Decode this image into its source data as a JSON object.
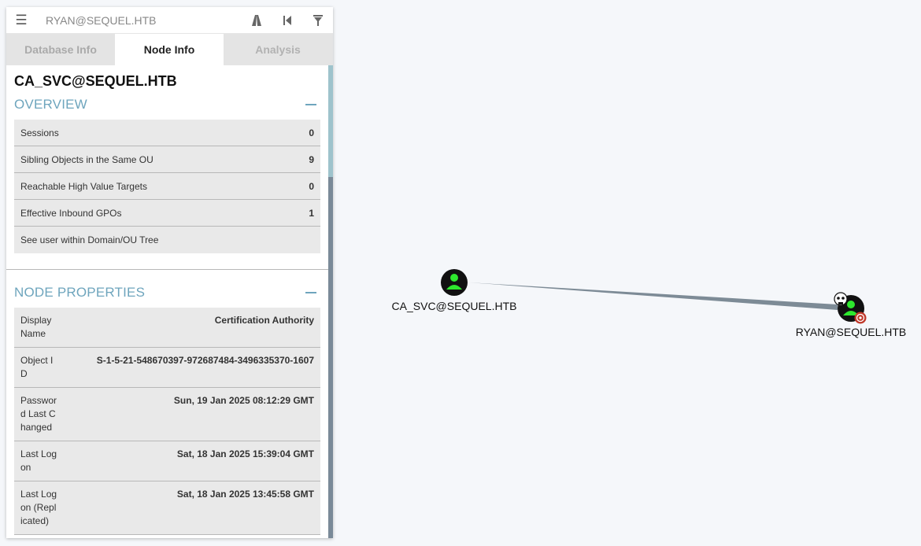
{
  "search": {
    "value": "RYAN@SEQUEL.HTB"
  },
  "tabs": [
    "Database Info",
    "Node Info",
    "Analysis"
  ],
  "node": {
    "title": "CA_SVC@SEQUEL.HTB"
  },
  "overview": {
    "title": "OVERVIEW",
    "rows": [
      {
        "label": "Sessions",
        "value": "0"
      },
      {
        "label": "Sibling Objects in the Same OU",
        "value": "9"
      },
      {
        "label": "Reachable High Value Targets",
        "value": "0"
      },
      {
        "label": "Effective Inbound GPOs",
        "value": "1"
      }
    ],
    "link": "See user within Domain/OU Tree"
  },
  "properties": {
    "title": "NODE PROPERTIES",
    "rows": [
      {
        "label": "Display Name",
        "value": "Certification Authority"
      },
      {
        "label": "Object ID",
        "value": "S-1-5-21-548670397-972687484-3496335370-1607"
      },
      {
        "label": "Password Last Changed",
        "value": "Sun, 19 Jan 2025 08:12:29 GMT"
      },
      {
        "label": "Last Logon",
        "value": "Sat, 18 Jan 2025 15:39:04 GMT"
      },
      {
        "label": "Last Logon (Replicated)",
        "value": "Sat, 18 Jan 2025 13:45:58 GMT"
      }
    ]
  },
  "graph": {
    "nodes": [
      {
        "label": "CA_SVC@SEQUEL.HTB"
      },
      {
        "label": "RYAN@SEQUEL.HTB"
      }
    ],
    "colors": {
      "user_fill": "#111111",
      "user_icon": "#2ee82e",
      "edge": "#7d8b96",
      "target": "#c0392b"
    }
  }
}
